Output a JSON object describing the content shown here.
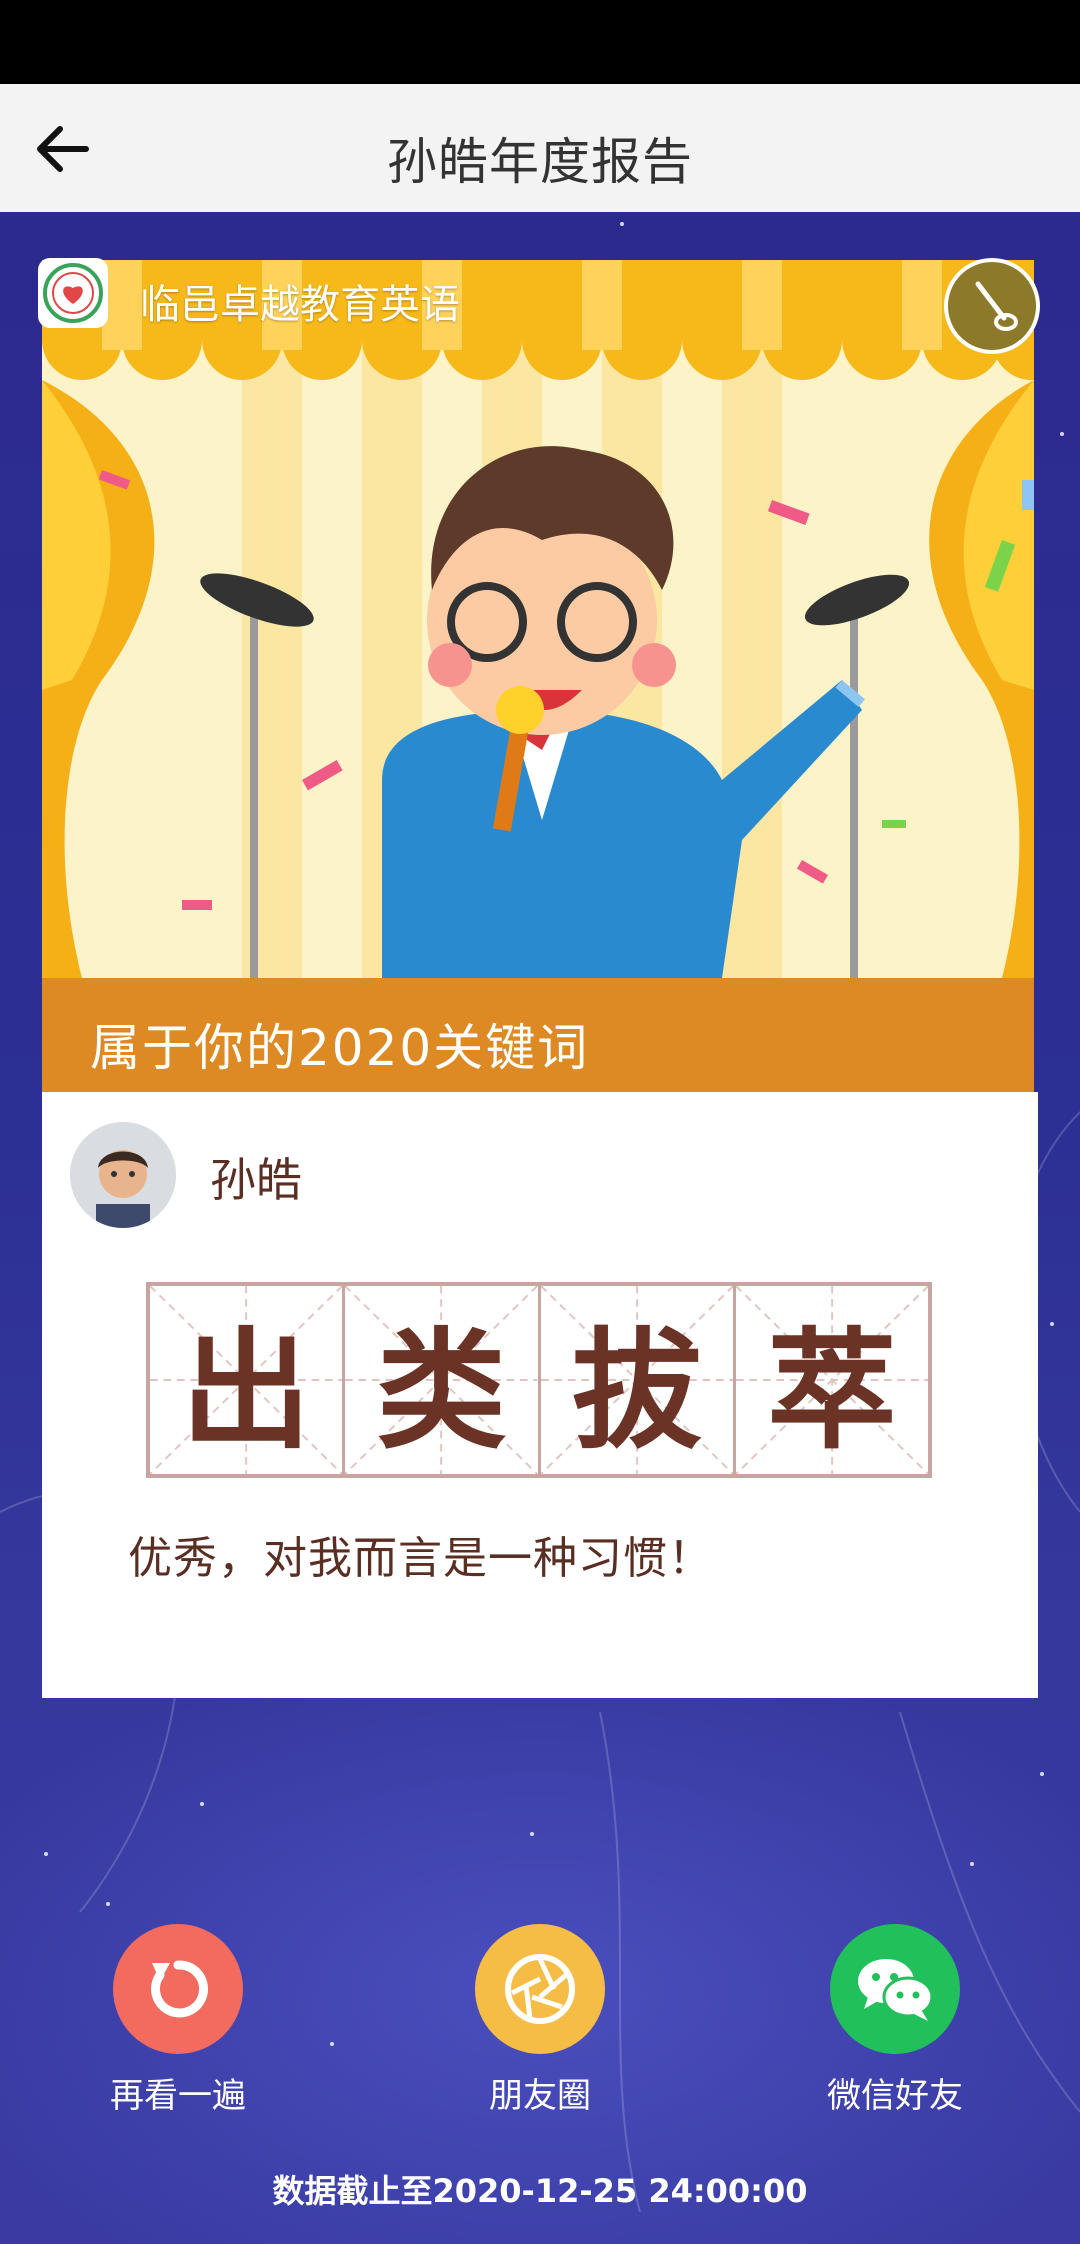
{
  "header": {
    "title": "孙皓年度报告"
  },
  "card": {
    "org_name": "临邑卓越教育英语",
    "keyword_heading": "属于你的2020关键词",
    "user_name": "孙皓",
    "idiom_chars": [
      "出",
      "类",
      "拔",
      "萃"
    ],
    "motto": "优秀，对我而言是一种习惯！"
  },
  "actions": [
    {
      "label": "再看一遍",
      "icon": "replay-icon",
      "color": "#f26b5e"
    },
    {
      "label": "朋友圈",
      "icon": "moments-shutter-icon",
      "color": "#f5bd45"
    },
    {
      "label": "微信好友",
      "icon": "wechat-icon",
      "color": "#22c05a"
    }
  ],
  "footer": {
    "data_cutoff": "数据截止至2020-12-25 24:00:00"
  },
  "colors": {
    "nav_bg": "#f3f3f3",
    "keyword_bar": "#dd8a25",
    "idiom_text": "#6b3326",
    "page_bg": "#2f2f8a"
  }
}
